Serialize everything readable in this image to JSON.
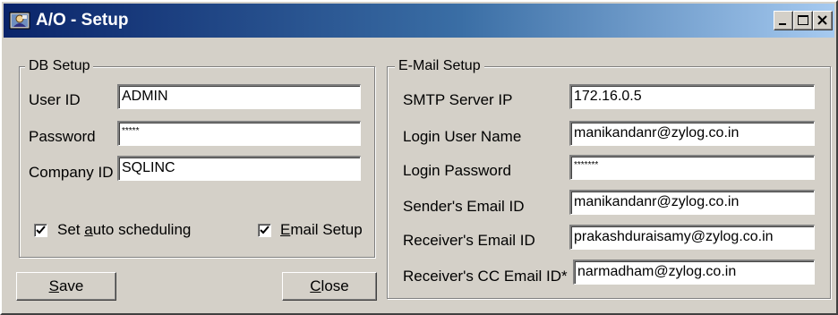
{
  "window": {
    "title": "A/O - Setup",
    "colors": {
      "titlebar_start": "#0a246a",
      "titlebar_end": "#a6caf0",
      "face": "#d4d0c8"
    },
    "icons": [
      "app-icon",
      "minimize-icon",
      "maximize-icon",
      "close-icon"
    ]
  },
  "db_setup": {
    "legend": "DB Setup",
    "user_id_label": "User ID",
    "user_id_value": "ADMIN",
    "password_label": "Password",
    "password_value": "*****",
    "company_id_label": "Company ID",
    "company_id_value": "SQLINC",
    "auto_sched_label_pre": "Set ",
    "auto_sched_label_key": "a",
    "auto_sched_label_post": "uto scheduling",
    "auto_sched_checked": true,
    "email_setup_label_key": "E",
    "email_setup_label_post": "mail Setup",
    "email_setup_checked": true
  },
  "email_setup": {
    "legend": "E-Mail Setup",
    "smtp_label": "SMTP Server IP",
    "smtp_value": "172.16.0.5",
    "login_user_label": "Login User Name",
    "login_user_value": "manikandanr@zylog.co.in",
    "login_pw_label": "Login Password",
    "login_pw_value": "*******",
    "sender_label": "Sender's Email ID",
    "sender_value": "manikandanr@zylog.co.in",
    "receiver_label": "Receiver's Email ID",
    "receiver_value": "prakashduraisamy@zylog.co.in",
    "cc_label": "Receiver's CC Email ID*",
    "cc_value": "narmadham@zylog.co.in"
  },
  "buttons": {
    "save_key": "S",
    "save_rest": "ave",
    "close_key": "C",
    "close_rest": "lose"
  }
}
